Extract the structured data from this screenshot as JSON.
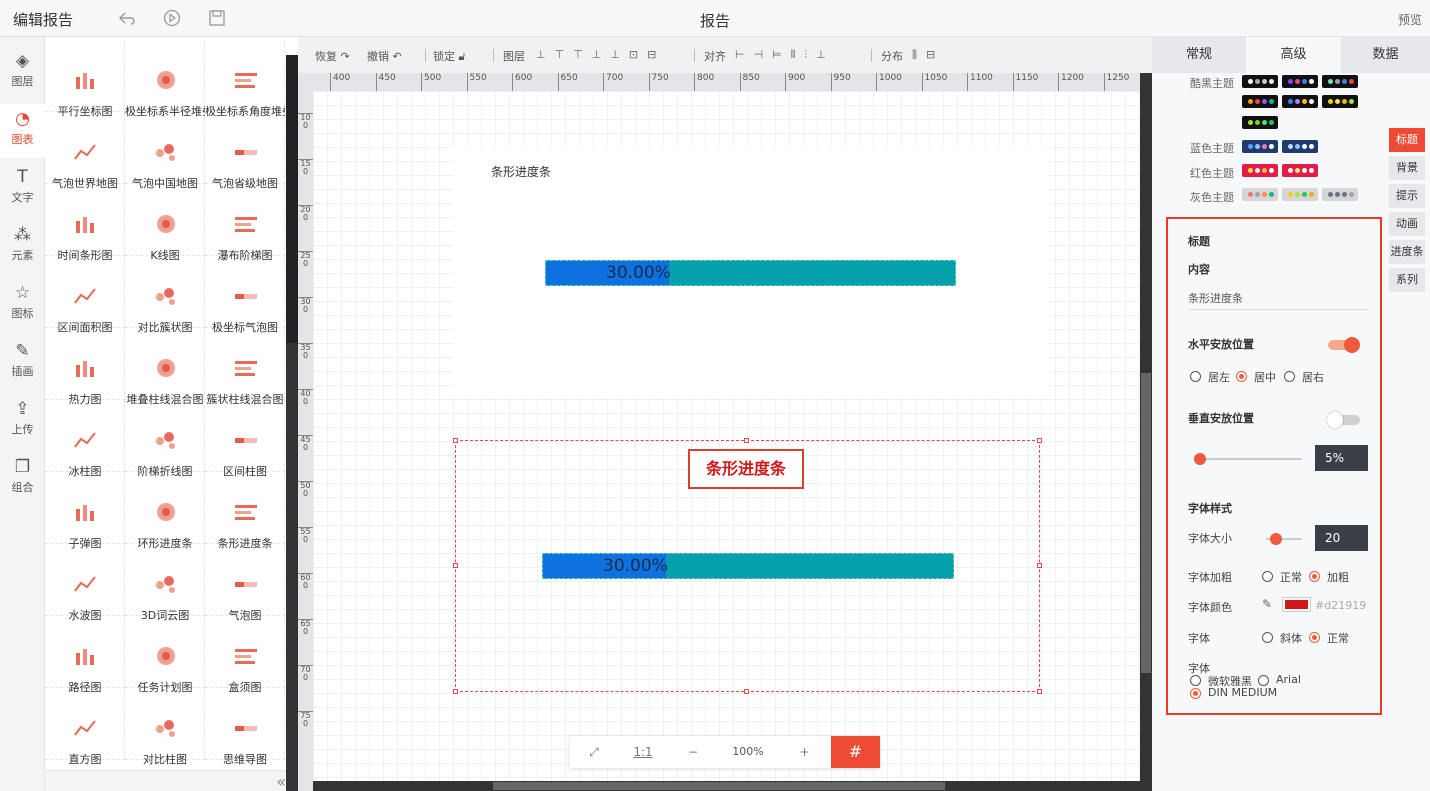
{
  "header": {
    "title": "编辑报告",
    "doc_title": "报告",
    "preview": "预览"
  },
  "leftnav": [
    {
      "label": "图层",
      "icon": "layers-icon"
    },
    {
      "label": "图表",
      "icon": "chart-icon",
      "active": true
    },
    {
      "label": "文字",
      "icon": "text-icon"
    },
    {
      "label": "元素",
      "icon": "elements-icon"
    },
    {
      "label": "图标",
      "icon": "star-icon"
    },
    {
      "label": "插画",
      "icon": "palette-icon"
    },
    {
      "label": "上传",
      "icon": "upload-icon"
    },
    {
      "label": "组合",
      "icon": "group-icon"
    }
  ],
  "gallery": [
    "平行坐标图",
    "极坐标系半径堆叠",
    "极坐标系角度堆叠",
    "气泡世界地图",
    "气泡中国地图",
    "气泡省级地图",
    "时间条形图",
    "K线图",
    "瀑布阶梯图",
    "区间面积图",
    "对比簇状图",
    "极坐标气泡图",
    "热力图",
    "堆叠柱线混合图",
    "簇状柱线混合图",
    "冰柱图",
    "阶梯折线图",
    "区间柱图",
    "子弹图",
    "环形进度条",
    "条形进度条",
    "水波图",
    "3D词云图",
    "气泡图",
    "路径图",
    "任务计划图",
    "盒须图",
    "直方图",
    "对比柱图",
    "思维导图"
  ],
  "toolbar": {
    "redo": "恢复",
    "undo": "撤销",
    "lock": "锁定",
    "layer": "图层",
    "align": "对齐",
    "distribute": "分布"
  },
  "ruler_ticks": [
    "400",
    "450",
    "500",
    "550",
    "600",
    "650",
    "700",
    "750",
    "800",
    "850",
    "900",
    "950",
    "1000",
    "1050",
    "1100",
    "1150",
    "1200",
    "1250"
  ],
  "ruler_vticks": [
    "100",
    "150",
    "200",
    "250",
    "300",
    "350",
    "400",
    "450",
    "500",
    "550",
    "600",
    "650",
    "700",
    "750"
  ],
  "widgets": {
    "top": {
      "title": "条形进度条",
      "percent_label": "30.00%",
      "progress": 0.3
    },
    "selected": {
      "title": "条形进度条",
      "percent_label": "30.00%",
      "progress": 0.3
    }
  },
  "zoom": {
    "fit": "⤢",
    "ratio": "1:1",
    "minus": "−",
    "level": "100%",
    "plus": "+",
    "grid": "#"
  },
  "right_panel": {
    "tabs": [
      "常规",
      "高级",
      "数据"
    ],
    "active_tab": "高级",
    "themes": [
      {
        "label": "酷黑主题"
      },
      {
        "label": "蓝色主题"
      },
      {
        "label": "红色主题"
      },
      {
        "label": "灰色主题"
      }
    ],
    "side_tabs": [
      "标题",
      "背景",
      "提示",
      "动画",
      "进度条",
      "系列"
    ],
    "title_section": {
      "heading": "标题",
      "content_label": "内容",
      "content_value": "条形进度条",
      "h_pos_label": "水平安放位置",
      "h_options": [
        "居左",
        "居中",
        "居右"
      ],
      "h_selected": "居中",
      "v_pos_label": "垂直安放位置",
      "v_value": "5%",
      "font_style_label": "字体样式",
      "font_size_label": "字体大小",
      "font_size_value": "20",
      "bold_label": "字体加粗",
      "bold_options": [
        "正常",
        "加粗"
      ],
      "bold_selected": "加粗",
      "color_label": "字体颜色",
      "color_value": "#d21919",
      "italic_label": "字体",
      "italic_options": [
        "斜体",
        "正常"
      ],
      "italic_selected": "正常",
      "family_label": "字体",
      "family_options": [
        "微软雅黑",
        "Arial",
        "DIN MEDIUM"
      ],
      "family_selected": "DIN MEDIUM"
    }
  },
  "colors": {
    "accent": "#ee4b35",
    "bar_fill": "#0d72e0",
    "bar_track": "#06a0ad",
    "title_red": "#d21919"
  }
}
